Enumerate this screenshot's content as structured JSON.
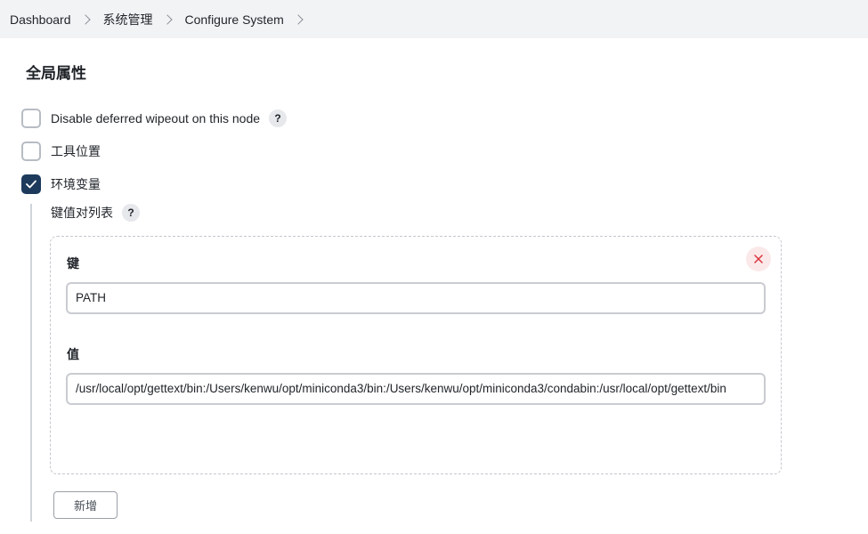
{
  "breadcrumb": {
    "items": [
      "Dashboard",
      "系统管理",
      "Configure System"
    ]
  },
  "section": {
    "title": "全局属性"
  },
  "options": [
    {
      "label": "Disable deferred wipeout on this node",
      "checked": false,
      "help": "?"
    },
    {
      "label": "工具位置",
      "checked": false
    },
    {
      "label": "环境变量",
      "checked": true
    }
  ],
  "env_vars": {
    "list_label": "键值对列表",
    "help": "?",
    "entries": [
      {
        "key_label": "键",
        "key_value": "PATH",
        "value_label": "值",
        "value_value": "/usr/local/opt/gettext/bin:/Users/kenwu/opt/miniconda3/bin:/Users/kenwu/opt/miniconda3/condabin:/usr/local/opt/gettext/bin"
      }
    ],
    "add_label": "新增"
  },
  "colors": {
    "accent": "#1d3a5c",
    "delete": "#d9363e"
  }
}
